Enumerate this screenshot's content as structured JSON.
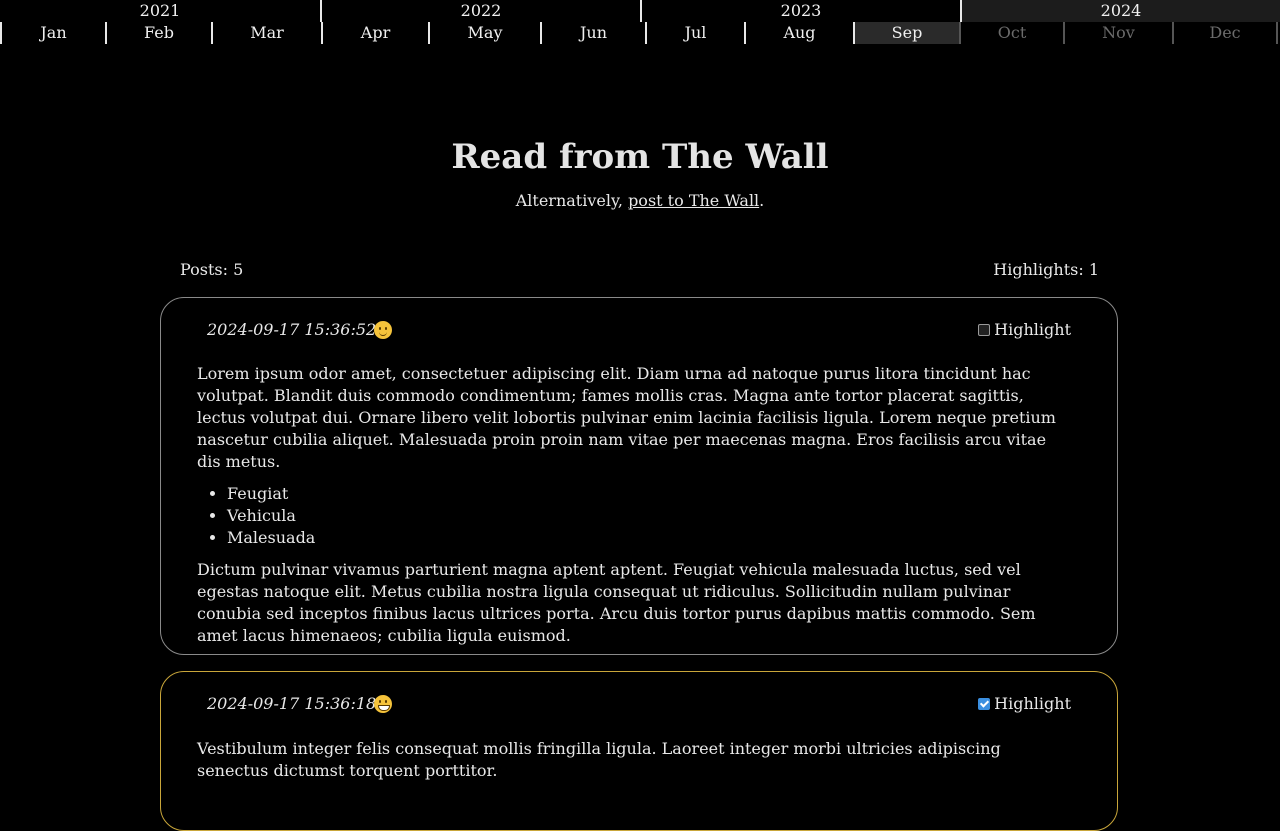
{
  "timeline": {
    "years": [
      {
        "label": "2021"
      },
      {
        "label": "2022"
      },
      {
        "label": "2023"
      },
      {
        "label": "2024"
      }
    ],
    "active_year": "2024",
    "months": [
      {
        "label": "Jan"
      },
      {
        "label": "Feb"
      },
      {
        "label": "Mar"
      },
      {
        "label": "Apr"
      },
      {
        "label": "May"
      },
      {
        "label": "Jun"
      },
      {
        "label": "Jul"
      },
      {
        "label": "Aug"
      },
      {
        "label": "Sep"
      },
      {
        "label": "Oct"
      },
      {
        "label": "Nov"
      },
      {
        "label": "Dec"
      }
    ],
    "active_month": "Sep",
    "disabled_months": [
      "Oct",
      "Nov",
      "Dec"
    ]
  },
  "page": {
    "title": "Read from The Wall",
    "subtitle_prefix": "Alternatively, ",
    "subtitle_link": "post to The Wall",
    "subtitle_suffix": "."
  },
  "stats": {
    "posts": "Posts: 5",
    "highlights": "Highlights: 1"
  },
  "highlight_label": "Highlight",
  "colors": {
    "background": "#000000",
    "highlight_border": "#c9a63a",
    "post_border": "#8a8a8a",
    "checkbox_checked": "#3b8fe0"
  },
  "posts": [
    {
      "timestamp": "2024-09-17 15:36:52",
      "emoji": "slightly-smiling-face-icon",
      "highlighted": false,
      "paragraph1": "Lorem ipsum odor amet, consectetuer adipiscing elit. Diam urna ad natoque purus litora tincidunt hac volutpat. Blandit duis commodo condimentum; fames mollis cras. Magna ante tortor placerat sagittis, lectus volutpat dui. Ornare libero velit lobortis pulvinar enim lacinia facilisis ligula. Lorem neque pretium nascetur cubilia aliquet. Malesuada proin proin nam vitae per maecenas magna. Eros facilisis arcu vitae dis metus.",
      "list": [
        "Feugiat",
        "Vehicula",
        "Malesuada"
      ],
      "paragraph2": "Dictum pulvinar vivamus parturient magna aptent aptent. Feugiat vehicula malesuada luctus, sed vel egestas natoque elit. Metus cubilia nostra ligula consequat ut ridiculus. Sollicitudin nullam pulvinar conubia sed inceptos finibus lacus ultrices porta. Arcu duis tortor purus dapibus mattis commodo. Sem amet lacus himenaeos; cubilia ligula euismod."
    },
    {
      "timestamp": "2024-09-17 15:36:18",
      "emoji": "grinning-face-icon",
      "highlighted": true,
      "paragraph1": "Vestibulum integer felis consequat mollis fringilla ligula. Laoreet integer morbi ultricies adipiscing senectus dictumst torquent porttitor."
    }
  ]
}
